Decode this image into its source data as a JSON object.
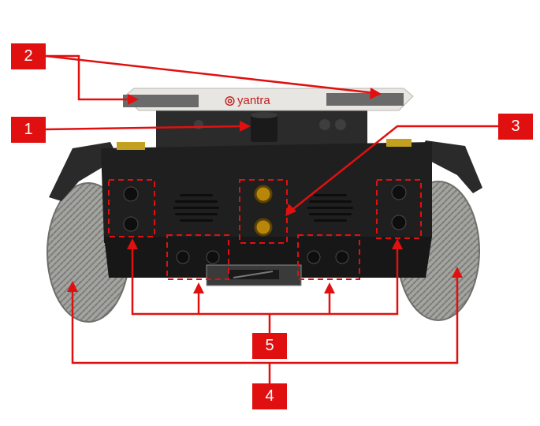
{
  "image": {
    "subject": "robot-base-rear-view",
    "brand_label": "yantra"
  },
  "callouts": [
    {
      "label": "1"
    },
    {
      "label": "2"
    },
    {
      "label": "3"
    },
    {
      "label": "4"
    },
    {
      "label": "5"
    }
  ],
  "colors": {
    "callout": "#e01010",
    "chassis": "#1e1e1e",
    "wheel": "#9a9a96",
    "top_plate": "#e8e6e2"
  }
}
